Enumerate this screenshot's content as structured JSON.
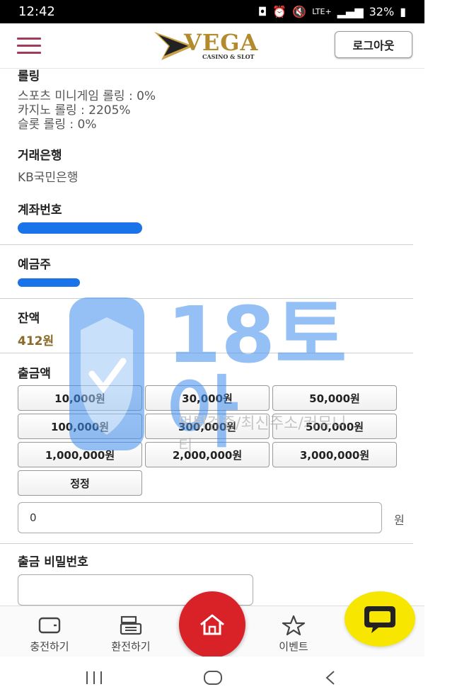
{
  "status_bar": {
    "time": "12:42",
    "network": "LTE+",
    "battery": "32%"
  },
  "header": {
    "logo_main": "VEGA",
    "logo_sub": "CASINO & SLOT",
    "logout_label": "로그아웃"
  },
  "rolling": {
    "title": "롤링",
    "lines": [
      "스포츠 미니게임 롤링 : 0%",
      "카지노 롤링 : 2205%",
      "슬롯 롤링 : 0%"
    ]
  },
  "bank": {
    "title": "거래은행",
    "value": "KB국민은행"
  },
  "account": {
    "title": "계좌번호"
  },
  "holder": {
    "title": "예금주"
  },
  "balance": {
    "title": "잔액",
    "value": "412원"
  },
  "withdraw": {
    "title": "출금액",
    "amount_buttons": [
      "10,000원",
      "30,000원",
      "50,000원",
      "100,000원",
      "300,000원",
      "500,000원",
      "1,000,000원",
      "2,000,000원",
      "3,000,000원"
    ],
    "reset_label": "정정",
    "amount_value": "0",
    "unit": "원"
  },
  "password": {
    "title": "출금 비밀번호"
  },
  "watermark": {
    "brand": "18토아",
    "tagline": "먹튀검증/최신주소/커뮤니티"
  },
  "bottom_nav": {
    "items": [
      "충전하기",
      "환전하기",
      "이벤트"
    ]
  },
  "colors": {
    "accent_red": "#d92128",
    "chat_yellow": "#f7e600",
    "gold": "#b38a2e",
    "mask_blue": "#1a73e8"
  }
}
